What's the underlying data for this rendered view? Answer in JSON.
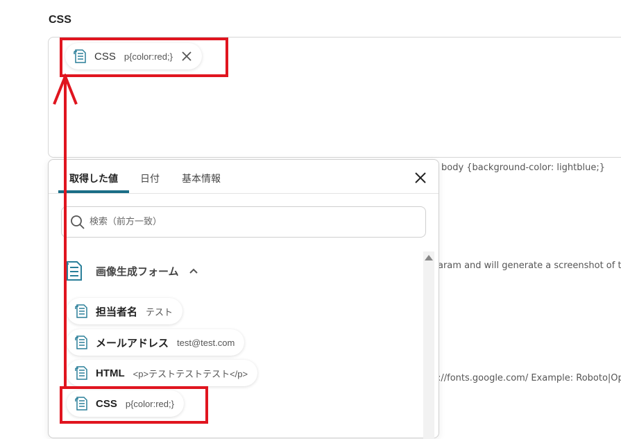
{
  "section": {
    "label": "CSS"
  },
  "field": {
    "chip": {
      "name": "CSS",
      "value": "p{color:red;}"
    }
  },
  "helpers": {
    "css_example": "body {background-color: lightblue;}",
    "param_note": "aram and will generate a screenshot of th",
    "font_note": "://fonts.google.com/ Example: Roboto|Op"
  },
  "panel": {
    "tabs": [
      {
        "label": "取得した値",
        "active": true
      },
      {
        "label": "日付",
        "active": false
      },
      {
        "label": "基本情報",
        "active": false
      }
    ],
    "search": {
      "placeholder": "検索（前方一致）"
    },
    "group": {
      "title": "画像生成フォーム",
      "expanded": true
    },
    "items": [
      {
        "name": "担当者名",
        "value": "テスト"
      },
      {
        "name": "メールアドレス",
        "value": "test@test.com"
      },
      {
        "name": "HTML",
        "value": "<p>テストテストテスト</p>"
      },
      {
        "name": "CSS",
        "value": "p{color:red;}"
      }
    ]
  },
  "colors": {
    "accent": "#1b6e87",
    "annotation_red": "#e0151f",
    "icon": "#2a7f99"
  },
  "icons": {
    "chip_icon": "form-field-icon",
    "close": "close-icon",
    "search": "search-icon",
    "group": "form-icon",
    "chevron": "chevron-up-icon"
  }
}
